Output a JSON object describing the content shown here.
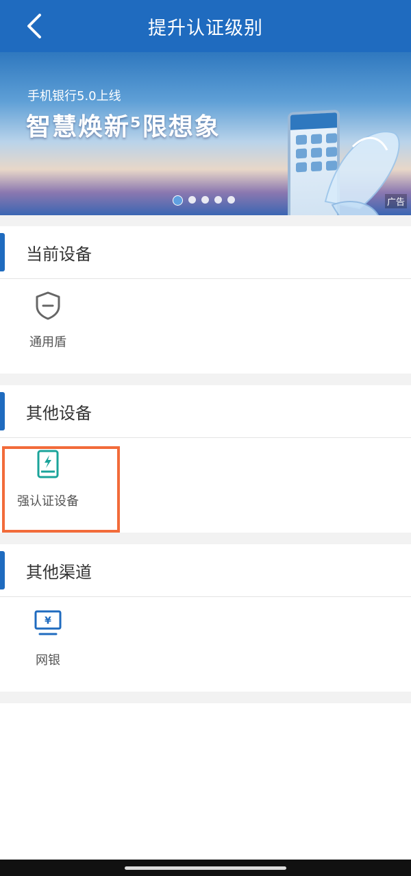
{
  "header": {
    "title": "提升认证级别"
  },
  "banner": {
    "subtitle": "手机银行5.0上线",
    "headline": "智慧焕新⁵限想象",
    "ad_tag": "广告",
    "slide_count": 5,
    "active_slide": 1
  },
  "sections": [
    {
      "title": "当前设备",
      "items": [
        {
          "label": "通用盾",
          "icon": "shield-icon"
        }
      ]
    },
    {
      "title": "其他设备",
      "items": [
        {
          "label": "强认证设备",
          "icon": "tablet-bolt-icon"
        }
      ]
    },
    {
      "title": "其他渠道",
      "items": [
        {
          "label": "网银",
          "icon": "monitor-yen-icon"
        }
      ]
    }
  ],
  "colors": {
    "brand": "#1f6bbf",
    "highlight": "#f26b3a",
    "teal": "#1aa39a"
  }
}
